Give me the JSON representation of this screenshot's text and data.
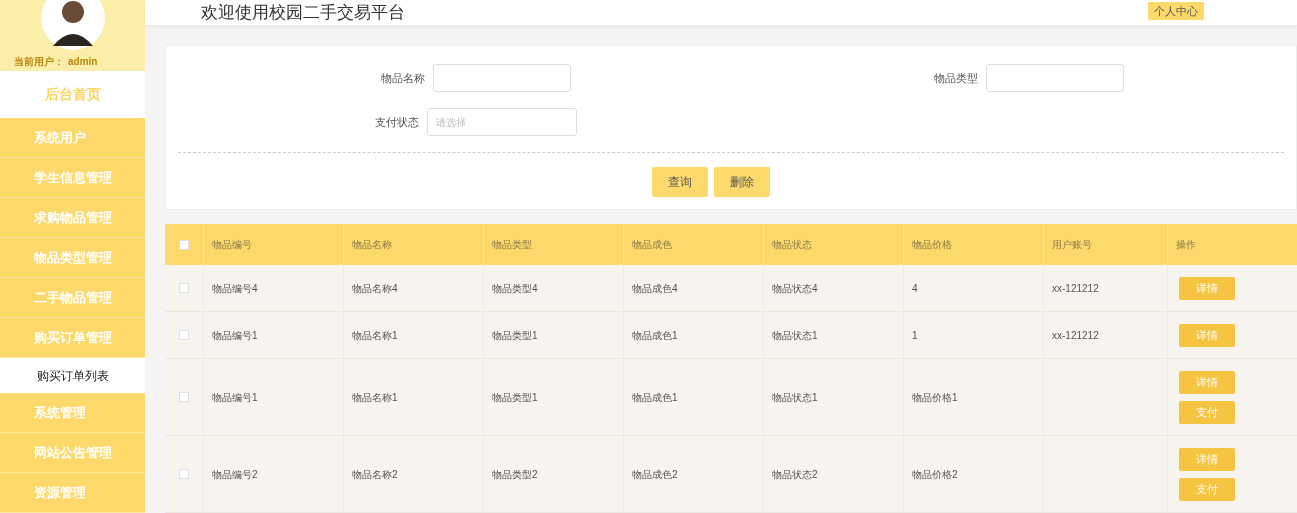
{
  "sidebar": {
    "current_user_label": "当前用户：",
    "current_user": "admin",
    "home": "后台首页",
    "items": [
      {
        "label": "系统用户",
        "selected": false
      },
      {
        "label": "学生信息管理",
        "selected": false
      },
      {
        "label": "求购物品管理",
        "selected": false
      },
      {
        "label": "物品类型管理",
        "selected": false
      },
      {
        "label": "二手物品管理",
        "selected": false
      },
      {
        "label": "购买订单管理",
        "selected": false,
        "children": [
          {
            "label": "购买订单列表",
            "selected": true
          }
        ]
      },
      {
        "label": "系统管理",
        "selected": false
      },
      {
        "label": "网站公告管理",
        "selected": false
      },
      {
        "label": "资源管理",
        "selected": false
      }
    ]
  },
  "header": {
    "title": "欢迎使用校园二手交易平台",
    "profile_button": "个人中心"
  },
  "search": {
    "fields": [
      {
        "label": "物品名称",
        "kind": "input"
      },
      {
        "label": "物品类型",
        "kind": "input"
      },
      {
        "label": "支付状态",
        "kind": "select",
        "placeholder": "请选择"
      }
    ],
    "buttons": [
      "查询",
      "删除"
    ]
  },
  "table": {
    "columns": [
      "物品编号",
      "物品名称",
      "物品类型",
      "物品成色",
      "物品状态",
      "物品价格",
      "用户账号",
      "操作"
    ],
    "header_checked": false,
    "rows": [
      {
        "checked": false,
        "cells": [
          "物品编号4",
          "物品名称4",
          "物品类型4",
          "物品成色4",
          "物品状态4",
          "4",
          "xx-121212"
        ],
        "actions": [
          "详情"
        ]
      },
      {
        "checked": false,
        "cells": [
          "物品编号1",
          "物品名称1",
          "物品类型1",
          "物品成色1",
          "物品状态1",
          "1",
          "xx-121212"
        ],
        "actions": [
          "详情"
        ]
      },
      {
        "checked": false,
        "cells": [
          "物品编号1",
          "物品名称1",
          "物品类型1",
          "物品成色1",
          "物品状态1",
          "物品价格1",
          ""
        ],
        "actions": [
          "详情",
          "支付"
        ]
      },
      {
        "checked": false,
        "cells": [
          "物品编号2",
          "物品名称2",
          "物品类型2",
          "物品成色2",
          "物品状态2",
          "物品价格2",
          ""
        ],
        "actions": [
          "详情",
          "支付"
        ]
      }
    ]
  }
}
